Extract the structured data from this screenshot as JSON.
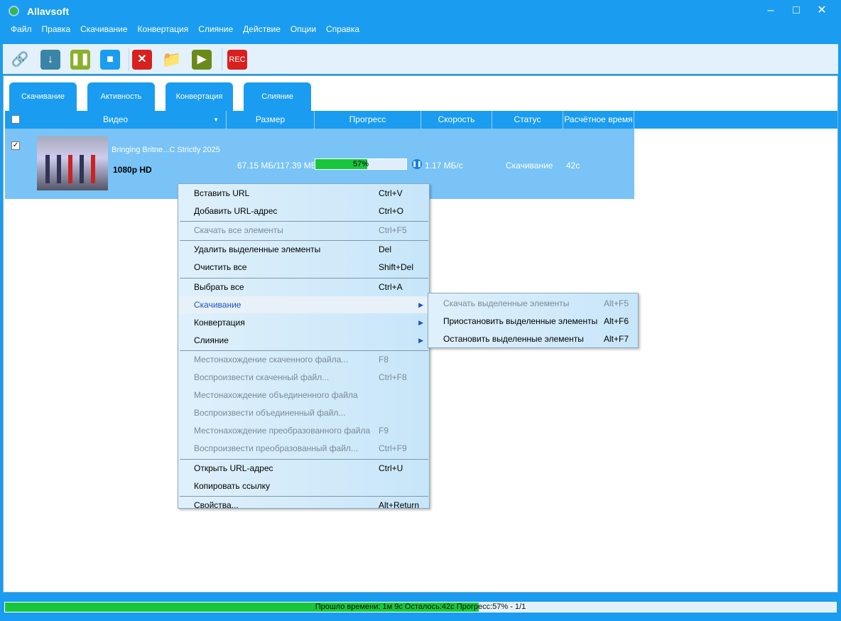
{
  "app": {
    "title": "Allavsoft"
  },
  "menu": [
    "Файл",
    "Правка",
    "Скачивание",
    "Конвертация",
    "Слияние",
    "Действие",
    "Опции",
    "Справка"
  ],
  "toolbar": {
    "rec_label": "REC"
  },
  "tabs": [
    "Скачивание",
    "Активность",
    "Конвертация",
    "Слияние"
  ],
  "columns": [
    "Видео",
    "Размер",
    "Прогресс",
    "Скорость",
    "Статус",
    "Расчётное время"
  ],
  "row": {
    "title": "Bringing Britne...C Strictly 2025",
    "quality": "1080p HD",
    "size": "67.15 МБ/117.39 МБ",
    "progress_label": "57%",
    "progress": 57,
    "speed": "1.17 МБ/с",
    "status": "Скачивание",
    "eta": "42с",
    "checked": true
  },
  "context_menu": [
    {
      "label": "Вставить URL",
      "key": "Ctrl+V"
    },
    {
      "label": "Добавить URL-адрес",
      "key": "Ctrl+O"
    },
    {
      "label": "Скачать все элементы",
      "key": "Ctrl+F5",
      "disabled": true
    },
    {
      "label": "Удалить выделенные элементы",
      "key": "Del"
    },
    {
      "label": "Очистить все",
      "key": "Shift+Del"
    },
    {
      "label": "Выбрать все",
      "key": "Ctrl+A"
    },
    {
      "label": "Скачивание",
      "key": "",
      "submenu": true,
      "highlight": true
    },
    {
      "label": "Конвертация",
      "key": "",
      "submenu": true
    },
    {
      "label": "Слияние",
      "key": "",
      "submenu": true
    },
    {
      "label": "Местонахождение скаченного файла...",
      "key": "F8",
      "disabled": true
    },
    {
      "label": "Воспроизвести скаченный файл...",
      "key": "Ctrl+F8",
      "disabled": true
    },
    {
      "label": "Местонахождение объединенного файла",
      "key": "",
      "disabled": true
    },
    {
      "label": "Воспроизвести объединенный файл...",
      "key": "",
      "disabled": true
    },
    {
      "label": "Местонахождение преобразованного файла",
      "key": "F9",
      "disabled": true
    },
    {
      "label": "Воспроизвести преобразованный файл...",
      "key": "Ctrl+F9",
      "disabled": true
    },
    {
      "label": "Открыть URL-адрес",
      "key": "Ctrl+U"
    },
    {
      "label": "Копировать ссылку",
      "key": ""
    },
    {
      "label": "Свойства...",
      "key": "Alt+Return"
    }
  ],
  "submenu": [
    {
      "label": "Скачать выделенные элементы",
      "key": "Alt+F5",
      "disabled": true
    },
    {
      "label": "Приостановить выделенные элементы",
      "key": "Alt+F6"
    },
    {
      "label": "Остановить выделенные элементы",
      "key": "Alt+F7"
    }
  ],
  "status": {
    "text": "Прошло времени: 1м  9с Осталось:42с Прогресс:57% - 1/1",
    "progress": 57
  }
}
